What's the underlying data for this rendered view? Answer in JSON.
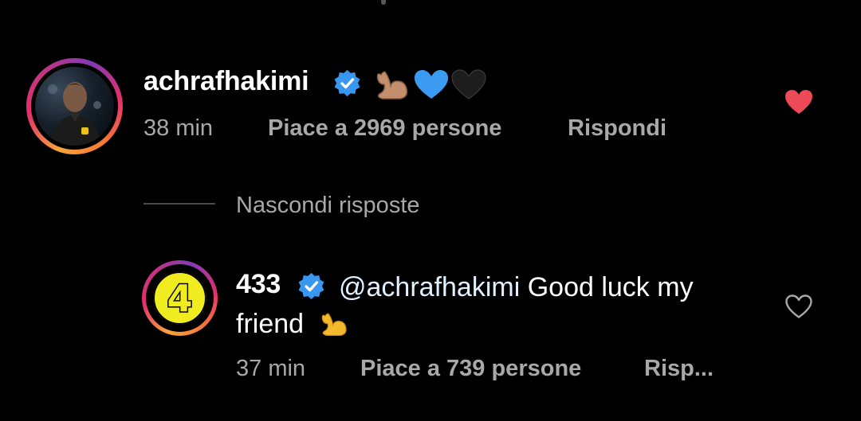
{
  "comments": [
    {
      "username": "achrafhakimi",
      "verified": true,
      "emojis": [
        "💪🏽",
        "💙",
        "🖤"
      ],
      "time": "38 min",
      "likes": "Piace a 2969 persone",
      "reply": "Rispondi",
      "liked": true
    },
    {
      "username": "433",
      "verified": true,
      "mention": "@achrafhakimi",
      "text": "Good luck my friend",
      "emoji": "💪",
      "avatar_label": "4",
      "time": "37 min",
      "likes": "Piace a 739 persone",
      "reply": "Risp...",
      "liked": false
    }
  ],
  "replies_toggle": "Nascondi risposte",
  "colors": {
    "background": "#000000",
    "text_primary": "#ffffff",
    "text_secondary": "#a8a8a8",
    "verified": "#3897f0",
    "heart": "#ed4956",
    "badge_yellow": "#f1ec1f"
  }
}
